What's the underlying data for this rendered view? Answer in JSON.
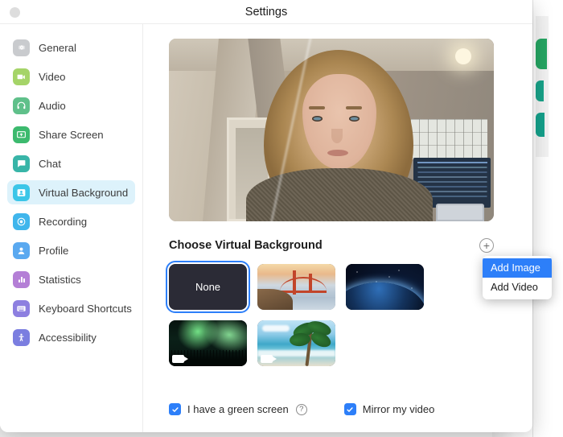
{
  "window": {
    "title": "Settings",
    "close_button": "close-window"
  },
  "sidebar": {
    "items": [
      {
        "label": "General",
        "icon": "gear-icon",
        "color": "#c9cbce",
        "active": false
      },
      {
        "label": "Video",
        "icon": "video-icon",
        "color": "#a5d468",
        "active": false
      },
      {
        "label": "Audio",
        "icon": "headset-icon",
        "color": "#5fc08a",
        "active": false
      },
      {
        "label": "Share Screen",
        "icon": "share-icon",
        "color": "#3cba6e",
        "active": false
      },
      {
        "label": "Chat",
        "icon": "chat-icon",
        "color": "#38b5a8",
        "active": false
      },
      {
        "label": "Virtual Background",
        "icon": "person-card-icon",
        "color": "#3cc6e8",
        "active": true
      },
      {
        "label": "Recording",
        "icon": "record-icon",
        "color": "#40b6ec",
        "active": false
      },
      {
        "label": "Profile",
        "icon": "profile-icon",
        "color": "#5aa9f0",
        "active": false
      },
      {
        "label": "Statistics",
        "icon": "bar-chart-icon",
        "color": "#b47fd6",
        "active": false
      },
      {
        "label": "Keyboard Shortcuts",
        "icon": "keyboard-icon",
        "color": "#8d7fe0",
        "active": false
      },
      {
        "label": "Accessibility",
        "icon": "accessibility-icon",
        "color": "#7b7ee0",
        "active": false
      }
    ],
    "active_color": "#ddf2fb"
  },
  "main": {
    "preview_label": "video-preview",
    "section_title": "Choose Virtual Background",
    "add_button_label": "+",
    "thumbnails": [
      {
        "name": "None",
        "label": "None",
        "selected": true,
        "has_video_badge": false,
        "art": "none"
      },
      {
        "name": "Golden Gate Bridge",
        "label": "",
        "selected": false,
        "has_video_badge": false,
        "art": "bridge"
      },
      {
        "name": "Earth from Space",
        "label": "",
        "selected": false,
        "has_video_badge": false,
        "art": "space"
      },
      {
        "name": "Northern Lights",
        "label": "",
        "selected": false,
        "has_video_badge": true,
        "art": "aurora"
      },
      {
        "name": "Tropical Beach",
        "label": "",
        "selected": false,
        "has_video_badge": true,
        "art": "beach"
      }
    ],
    "selection_color": "#2d7ff9"
  },
  "footer": {
    "green_screen": {
      "label": "I have a green screen",
      "checked": true,
      "help": "?"
    },
    "mirror_video": {
      "label": "Mirror my video",
      "checked": true
    }
  },
  "dropdown": {
    "visible": true,
    "items": [
      {
        "label": "Add Image",
        "highlighted": true
      },
      {
        "label": "Add Video",
        "highlighted": false
      }
    ],
    "highlight_color": "#2d7ff9"
  }
}
